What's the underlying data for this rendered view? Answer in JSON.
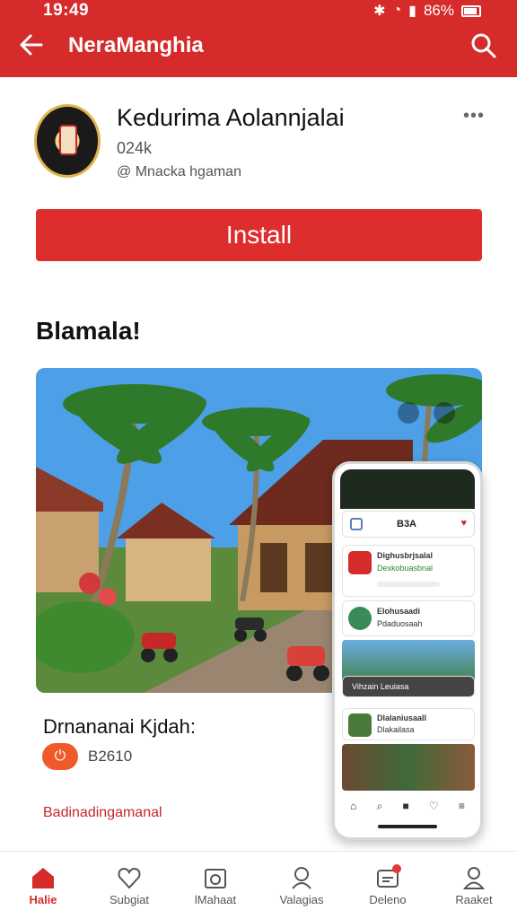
{
  "status": {
    "time": "19:49",
    "battery": "86%"
  },
  "appbar": {
    "title": "NeraManghia"
  },
  "app": {
    "title": "Kedurima Aolannjalai",
    "size": "024k",
    "developer": "@ Mnacka hgaman",
    "install_label": "Install"
  },
  "section": {
    "title": "Blamala!"
  },
  "preview": {
    "tab_label": "B3A",
    "items": [
      {
        "title": "Dighusbrjsalal",
        "sub": "Dexkobuasbnal"
      },
      {
        "title": "Elohusaadi",
        "sub": "Pdaduosaah"
      },
      {
        "title": "Vihzain Leuiasa"
      },
      {
        "title": "Dlalaniusaall",
        "sub": "Dlakailasa"
      }
    ]
  },
  "details": {
    "title": "Drnananai Kjdah:",
    "badge_text": "B2610",
    "link": "Badinadingamanal"
  },
  "nav": {
    "items": [
      {
        "label": "Halie",
        "icon": "home-icon",
        "active": true
      },
      {
        "label": "Subgiat",
        "icon": "heart-icon"
      },
      {
        "label": "lMahaat",
        "icon": "camera-icon"
      },
      {
        "label": "Valagias",
        "icon": "people-icon"
      },
      {
        "label": "Deleno",
        "icon": "notification-icon"
      },
      {
        "label": "Raaket",
        "icon": "profile-icon"
      }
    ]
  },
  "colors": {
    "primary": "#d62b2b",
    "accent": "#f05a2a"
  }
}
